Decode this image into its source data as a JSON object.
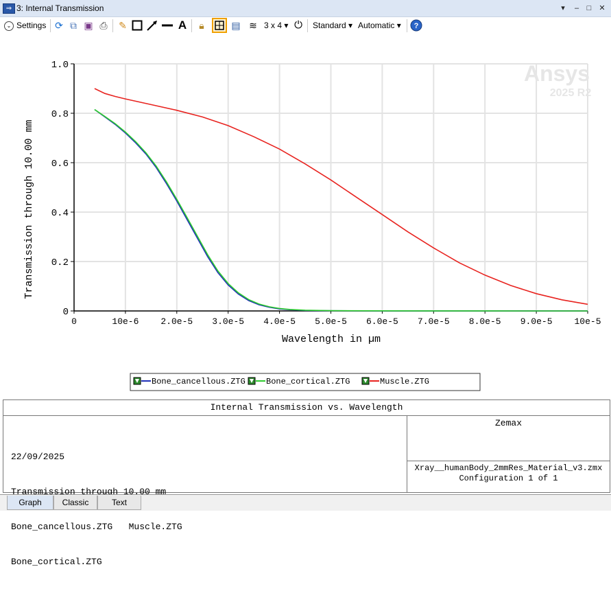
{
  "window": {
    "title": "3: Internal Transmission",
    "controls": [
      "▾",
      "–",
      "□",
      "✕"
    ]
  },
  "toolbar": {
    "settings_label": "Settings",
    "layout_label": "3 x 4",
    "standard_label": "Standard",
    "automatic_label": "Automatic"
  },
  "chart_data": {
    "type": "line",
    "xlabel": "Wavelength in µm",
    "ylabel": "Transmission through 10.00 mm",
    "xlim": [
      0,
      0.0001
    ],
    "ylim": [
      0,
      1.0
    ],
    "xtick_labels": [
      "0",
      "10e-6",
      "2.0e-5",
      "3.0e-5",
      "4.0e-5",
      "5.0e-5",
      "6.0e-5",
      "7.0e-5",
      "8.0e-5",
      "9.0e-5",
      "10e-5"
    ],
    "xtick_values": [
      0,
      1e-05,
      2e-05,
      3e-05,
      4e-05,
      5e-05,
      6e-05,
      7e-05,
      8e-05,
      9e-05,
      0.0001
    ],
    "ytick_labels": [
      "0",
      "0.2",
      "0.4",
      "0.6",
      "0.8",
      "1.0"
    ],
    "ytick_values": [
      0,
      0.2,
      0.4,
      0.6,
      0.8,
      1.0
    ],
    "grid": true,
    "watermark": {
      "brand": "Ansys",
      "version": "2025 R2"
    },
    "legend_position": "bottom-center",
    "series": [
      {
        "name": "Bone_cancellous.ZTG",
        "color": "#1f2fb8",
        "x": [
          4e-06,
          6e-06,
          8e-06,
          1e-05,
          1.2e-05,
          1.4e-05,
          1.6e-05,
          1.8e-05,
          2e-05,
          2.2e-05,
          2.4e-05,
          2.6e-05,
          2.8e-05,
          3e-05,
          3.2e-05,
          3.4e-05,
          3.6e-05,
          3.8e-05,
          4e-05,
          4.2e-05,
          4.5e-05,
          5e-05,
          6e-05,
          7e-05,
          8e-05,
          9e-05,
          0.0001
        ],
        "y": [
          0.815,
          0.785,
          0.755,
          0.72,
          0.68,
          0.635,
          0.58,
          0.515,
          0.445,
          0.37,
          0.295,
          0.22,
          0.155,
          0.105,
          0.068,
          0.042,
          0.025,
          0.015,
          0.008,
          0.005,
          0.002,
          0.0008,
          0.0003,
          0.0001,
          0.0,
          0.0,
          0.0
        ]
      },
      {
        "name": "Bone_cortical.ZTG",
        "color": "#2ecc2e",
        "x": [
          4e-06,
          6e-06,
          8e-06,
          1e-05,
          1.2e-05,
          1.4e-05,
          1.6e-05,
          1.8e-05,
          2e-05,
          2.2e-05,
          2.4e-05,
          2.6e-05,
          2.8e-05,
          3e-05,
          3.2e-05,
          3.4e-05,
          3.6e-05,
          3.8e-05,
          4e-05,
          4.2e-05,
          4.5e-05,
          5e-05,
          6e-05,
          7e-05,
          8e-05,
          9e-05,
          0.0001
        ],
        "y": [
          0.815,
          0.787,
          0.758,
          0.724,
          0.685,
          0.64,
          0.586,
          0.522,
          0.452,
          0.378,
          0.303,
          0.228,
          0.162,
          0.111,
          0.073,
          0.046,
          0.028,
          0.017,
          0.01,
          0.006,
          0.003,
          0.0012,
          0.0005,
          0.0002,
          0.0001,
          0.0,
          0.0
        ]
      },
      {
        "name": "Muscle.ZTG",
        "color": "#e8231f",
        "x": [
          4e-06,
          6e-06,
          8e-06,
          1e-05,
          1.5e-05,
          2e-05,
          2.5e-05,
          3e-05,
          3.5e-05,
          4e-05,
          4.5e-05,
          5e-05,
          5.5e-05,
          6e-05,
          6.5e-05,
          7e-05,
          7.5e-05,
          8e-05,
          8.5e-05,
          9e-05,
          9.5e-05,
          0.0001
        ],
        "y": [
          0.9,
          0.88,
          0.868,
          0.858,
          0.835,
          0.812,
          0.785,
          0.75,
          0.705,
          0.655,
          0.595,
          0.53,
          0.46,
          0.39,
          0.32,
          0.255,
          0.195,
          0.145,
          0.103,
          0.07,
          0.045,
          0.027
        ]
      }
    ]
  },
  "legend": [
    {
      "label": "Bone_cancellous.ZTG",
      "color": "#1f2fb8"
    },
    {
      "label": "Bone_cortical.ZTG",
      "color": "#2ecc2e"
    },
    {
      "label": "Muscle.ZTG",
      "color": "#e8231f"
    }
  ],
  "info_panel": {
    "header": "Internal Transmission vs. Wavelength",
    "date": "22/09/2025",
    "line1": "Transmission through 10.00 mm",
    "line2": "Bone_cancellous.ZTG   Muscle.ZTG",
    "line3": "Bone_cortical.ZTG",
    "company": "Zemax",
    "file": "Xray__humanBody_2mmRes_Material_v3.zmx",
    "config": "Configuration 1 of 1"
  },
  "tabs": [
    "Graph",
    "Classic",
    "Text"
  ]
}
